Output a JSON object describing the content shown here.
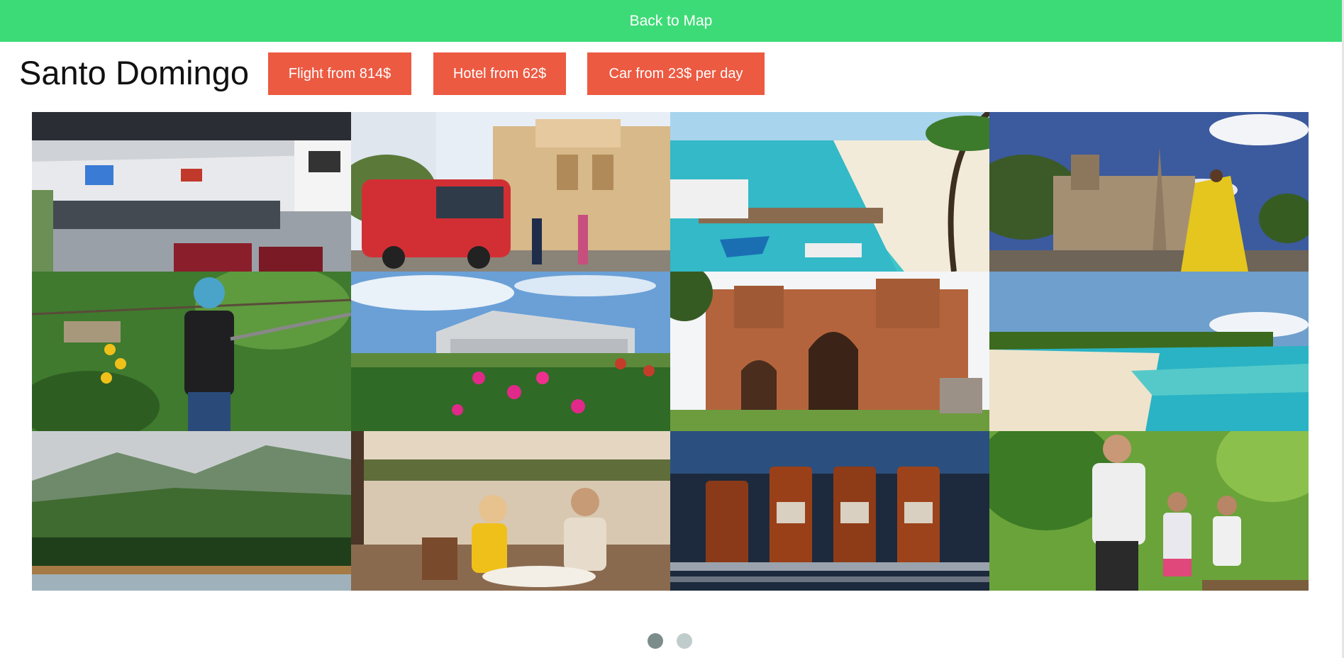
{
  "topbar": {
    "back_label": "Back to Map"
  },
  "header": {
    "city": "Santo Domingo",
    "flight_label": "Flight from 814$",
    "hotel_label": "Hotel from 62$",
    "car_label": "Car from 23$ per day"
  },
  "colors": {
    "topbar": "#3ddb77",
    "button": "#ec5a42",
    "dot_active": "#7b8c8b",
    "dot_inactive": "#c0cccb"
  },
  "gallery": {
    "photos": [
      "airport-lounge-photo",
      "tour-bus-cathedral-photo",
      "beach-pier-photo",
      "stone-church-dancer-photo",
      "zipline-photo",
      "hotel-garden-photo",
      "ruins-photo",
      "palm-beach-photo",
      "mountain-palms-photo",
      "couple-dinner-photo",
      "rum-bottles-photo",
      "segway-tour-photo"
    ]
  },
  "pagination": {
    "pages": 2,
    "current": 1
  }
}
